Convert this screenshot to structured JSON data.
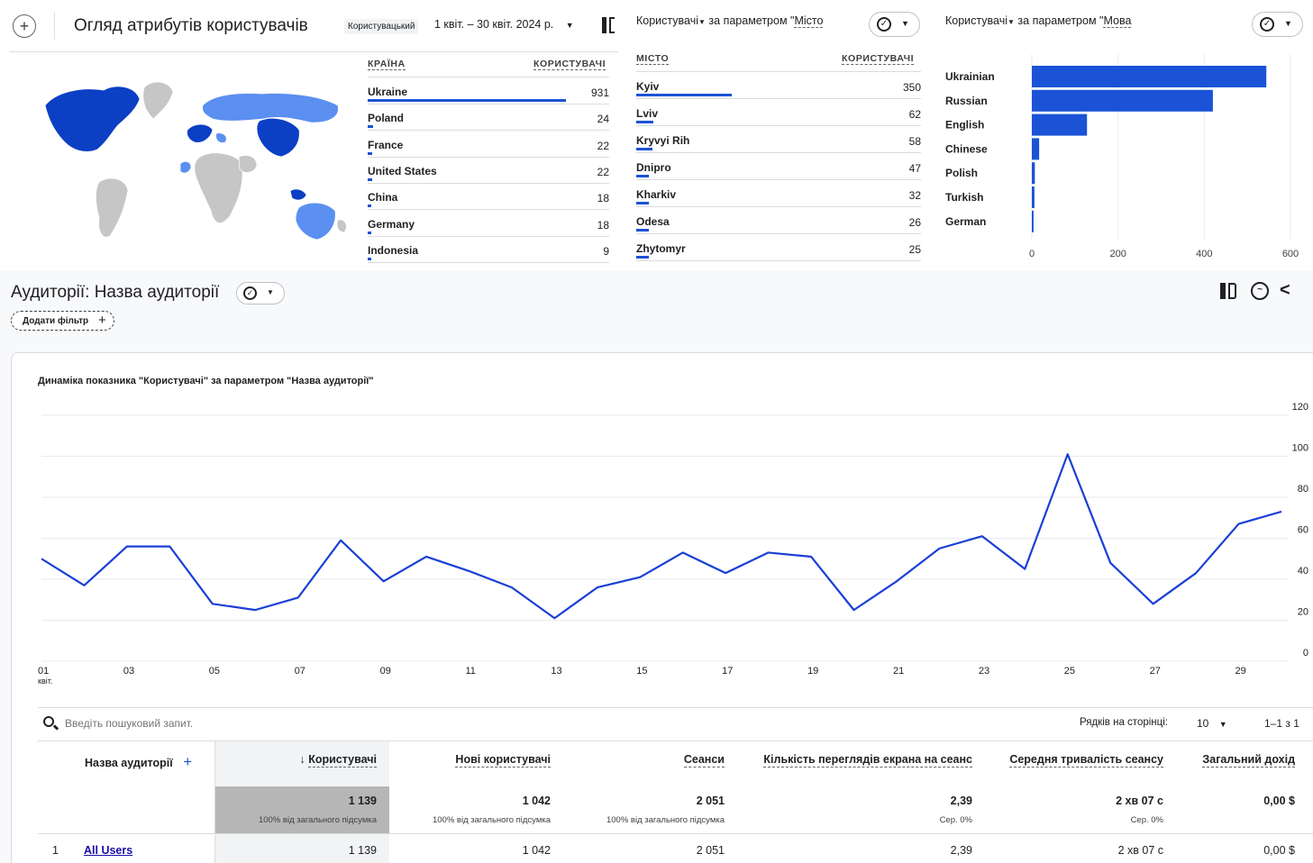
{
  "header": {
    "title": "Огляд атрибутів користувачів",
    "segment_label": "Користувацький",
    "date_range": "1 квіт. – 30 квіт. 2024 р."
  },
  "country_table": {
    "col_country": "КРАЇНА",
    "col_users": "КОРИСТУВАЧІ",
    "rows": [
      {
        "name": "Ukraine",
        "value": 931
      },
      {
        "name": "Poland",
        "value": 24
      },
      {
        "name": "France",
        "value": 22
      },
      {
        "name": "United States",
        "value": 22
      },
      {
        "name": "China",
        "value": 18
      },
      {
        "name": "Germany",
        "value": 18
      },
      {
        "name": "Indonesia",
        "value": 9
      }
    ]
  },
  "city_card": {
    "metric": "Користувачі",
    "title_rest": " за параметром \"",
    "dim": "Місто",
    "col_city": "МІСТО",
    "col_users": "КОРИСТУВАЧІ",
    "rows": [
      {
        "name": "Kyiv",
        "value": 350
      },
      {
        "name": "Lviv",
        "value": 62
      },
      {
        "name": "Kryvyi Rih",
        "value": 58
      },
      {
        "name": "Dnipro",
        "value": 47
      },
      {
        "name": "Kharkiv",
        "value": 32
      },
      {
        "name": "Odesa",
        "value": 26
      },
      {
        "name": "Zhytomyr",
        "value": 25
      }
    ]
  },
  "language_card": {
    "metric": "Користувачі",
    "title_rest": " за параметром \"",
    "dim": "Мова"
  },
  "audience": {
    "title": "Аудиторії: Назва аудиторії",
    "add_filter": "Додати фільтр",
    "chart_title": "Динаміка показника \"Користувачі\" за параметром \"Назва аудиторії\"",
    "search_placeholder": "Введіть пошуковий запит.",
    "rows_per_page_label": "Рядків на сторінці:",
    "rows_per_page_value": "10",
    "pagination": "1–1 з 1"
  },
  "table": {
    "columns": [
      "Назва аудиторії",
      "Користувачі",
      "Нові користувачі",
      "Сеанси",
      "Кількість переглядів екрана на сеанс",
      "Середня тривалість сеансу",
      "Загальний дохід"
    ],
    "totals": {
      "users": "1 139",
      "new_users": "1 042",
      "sessions": "2 051",
      "views_per_session": "2,39",
      "avg_duration": "2 хв 07 с",
      "revenue": "0,00 $",
      "pct_total": "100% від загального підсумка",
      "avg_note": "Сер. 0%"
    },
    "rows": [
      {
        "index": "1",
        "name": "All Users",
        "users": "1 139",
        "new_users": "1 042",
        "sessions": "2 051",
        "views_per_session": "2,39",
        "avg_duration": "2 хв 07 с",
        "revenue": "0,00 $"
      }
    ]
  },
  "colors": {
    "accent": "#1a53d6",
    "map_dark": "#0b3fc4",
    "map_light": "#5b8ff0",
    "map_gray": "#c6c6c6"
  },
  "chart_data": [
    {
      "type": "bar",
      "orientation": "horizontal",
      "categories": [
        "Ukrainian",
        "Russian",
        "English",
        "Chinese",
        "Polish",
        "Turkish",
        "German"
      ],
      "values": [
        544,
        420,
        128,
        17,
        7,
        6,
        4
      ],
      "xlim": [
        0,
        600
      ],
      "xticks": [
        0,
        200,
        400,
        600
      ],
      "grid": true
    },
    {
      "type": "line",
      "x": [
        "01",
        "02",
        "03",
        "04",
        "05",
        "06",
        "07",
        "08",
        "09",
        "10",
        "11",
        "12",
        "13",
        "14",
        "15",
        "16",
        "17",
        "18",
        "19",
        "20",
        "21",
        "22",
        "23",
        "24",
        "25",
        "26",
        "27",
        "28",
        "29",
        "30"
      ],
      "x_tick_labels": [
        "01",
        "03",
        "05",
        "07",
        "09",
        "11",
        "13",
        "15",
        "17",
        "19",
        "21",
        "23",
        "25",
        "27",
        "29"
      ],
      "x_sublabel": "квіт.",
      "series": [
        {
          "values": [
            50,
            37,
            56,
            56,
            28,
            25,
            31,
            59,
            39,
            51,
            44,
            36,
            21,
            36,
            41,
            53,
            43,
            53,
            51,
            25,
            39,
            55,
            61,
            45,
            101,
            48,
            28,
            43,
            67,
            73
          ]
        }
      ],
      "ylim": [
        0,
        120
      ],
      "yticks": [
        0,
        20,
        40,
        60,
        80,
        100,
        120
      ],
      "grid": true,
      "color": "#1a3fd6"
    }
  ]
}
